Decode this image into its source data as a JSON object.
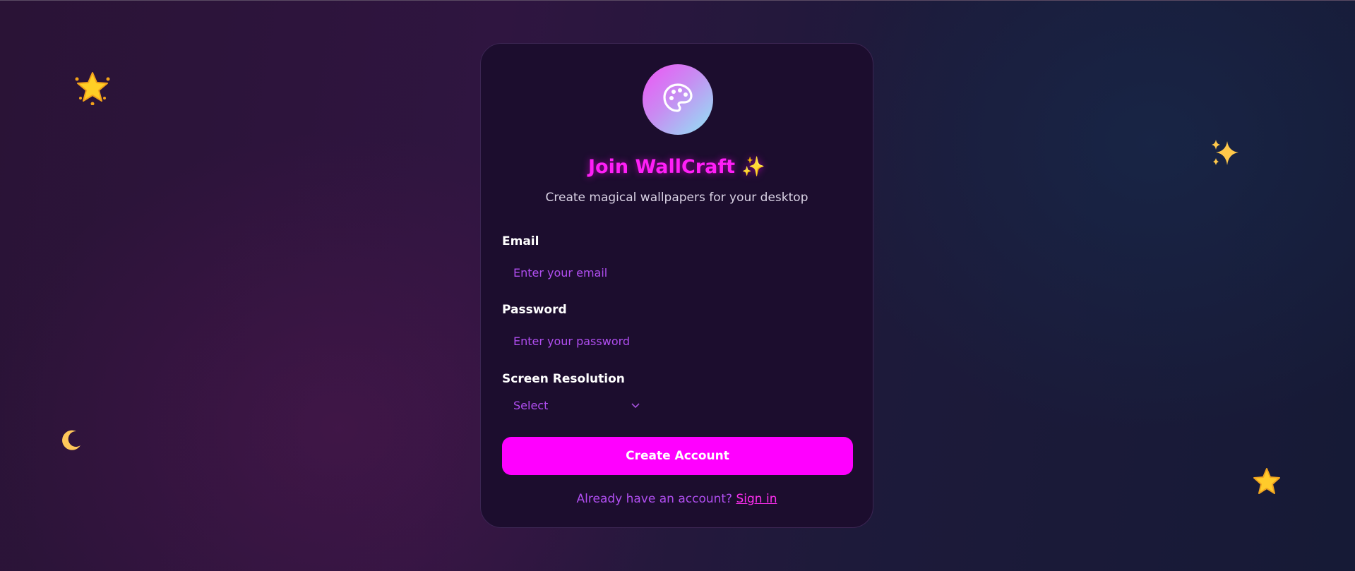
{
  "decorations": [
    {
      "name": "glowing-star-icon"
    },
    {
      "name": "sparkles-icon"
    },
    {
      "name": "crescent-moon-icon"
    },
    {
      "name": "star-icon"
    }
  ],
  "signup": {
    "logo_icon": "palette-icon",
    "title": "Join WallCraft ✨",
    "subtitle": "Create magical wallpapers for your desktop",
    "email": {
      "label": "Email",
      "placeholder": "Enter your email",
      "value": ""
    },
    "password": {
      "label": "Password",
      "placeholder": "Enter your password",
      "value": ""
    },
    "resolution": {
      "label": "Screen Resolution",
      "selected": "Select",
      "icon": "chevron-down-icon"
    },
    "submit_label": "Create Account",
    "footer_text": "Already have an account?",
    "signin_link": "Sign in"
  },
  "colors": {
    "accent": "#ff00ff",
    "title": "#ff1ff7",
    "placeholder": "#b04ef0",
    "card_bg": "#1c0d2e",
    "card_border": "#3b2552"
  }
}
